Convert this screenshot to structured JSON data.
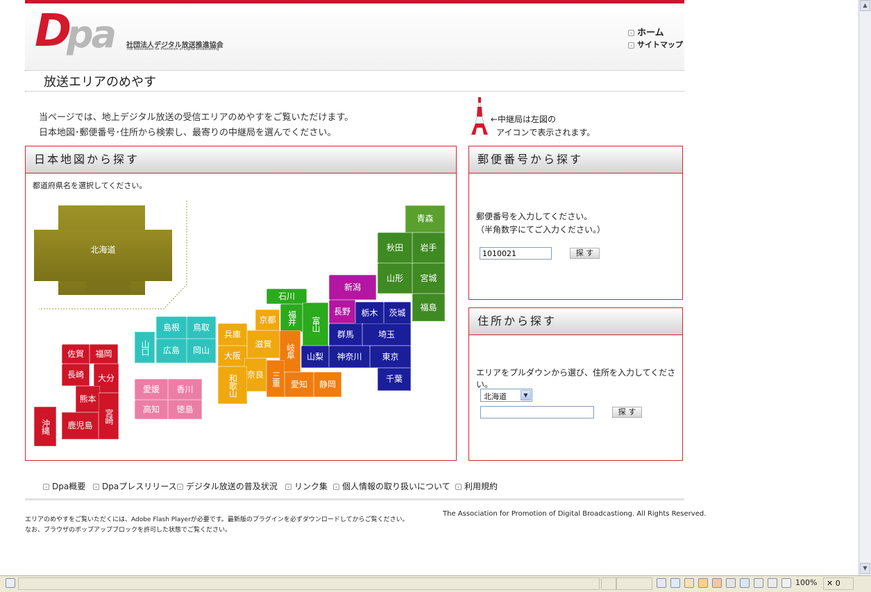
{
  "header": {
    "logo_d": "D",
    "logo_pa": "pa",
    "org_name_ja": "社団法人デジタル放送推進協会",
    "org_name_en": "The Association for Promotion of Digital Broadcasting",
    "nav_home": "ホーム",
    "nav_sitemap": "サイトマップ"
  },
  "page": {
    "title": "放送エリアのめやす",
    "intro_line1": "当ページでは、地上デジタル放送の受信エリアのめやすをご覧いただけます。",
    "intro_line2": "日本地図･郵便番号･住所から検索し、最寄りの中継局を選んでください。",
    "tower_note_line1": "←中継局は左図の",
    "tower_note_line2": "アイコンで表示されます。"
  },
  "map_panel": {
    "heading": "日本地図から探す",
    "instruction": "都道府県名を選択してください。",
    "prefectures": {
      "hokkaido": "北海道",
      "aomori": "青森",
      "akita": "秋田",
      "iwate": "岩手",
      "yamagata": "山形",
      "miyagi": "宮城",
      "fukushima": "福島",
      "niigata": "新潟",
      "nagano": "長野",
      "tochigi": "栃木",
      "ibaraki": "茨城",
      "gunma": "群馬",
      "saitama": "埼玉",
      "yamanashi": "山梨",
      "kanagawa": "神奈川",
      "tokyo": "東京",
      "chiba": "千葉",
      "ishikawa": "石川",
      "fukui": "福井",
      "toyama": "富山",
      "gifu": "岐阜",
      "aichi": "愛知",
      "shizuoka": "静岡",
      "mie": "三重",
      "kyoto": "京都",
      "hyogo": "兵庫",
      "shiga": "滋賀",
      "osaka": "大阪",
      "nara": "奈良",
      "wakayama": "和歌山",
      "shimane": "島根",
      "tottori": "鳥取",
      "yamaguchi": "山口",
      "hiroshima": "広島",
      "okayama": "岡山",
      "ehime": "愛媛",
      "kagawa": "香川",
      "kochi": "高知",
      "tokushima": "徳島",
      "saga": "佐賀",
      "fukuoka": "福岡",
      "nagasaki": "長崎",
      "oita": "大分",
      "kumamoto": "熊本",
      "miyazaki": "宮崎",
      "kagoshima": "鹿児島",
      "okinawa": "沖縄"
    },
    "colors": {
      "hokkaido": "#8a7f1e",
      "tohoku": "#3f8a22",
      "aomori": "#5aa02e",
      "kanto": "#1a1e9a",
      "chubu_n": "#2aaa1c",
      "chubu": "#ef7c0e",
      "kinki": "#efa80e",
      "koshinetsu": "#b316a0",
      "chugoku": "#2fc3bd",
      "shikoku": "#ec7ea6",
      "kyushu": "#cf1528"
    }
  },
  "postal_panel": {
    "heading": "郵便番号から探す",
    "instruction_line1": "郵便番号を入力してください。",
    "instruction_line2": "（半角数字にてご入力ください。）",
    "input_value": "1010021",
    "search_button": "探 す"
  },
  "address_panel": {
    "heading": "住所から探す",
    "instruction": "エリアをプルダウンから選び、住所を入力してください。",
    "selected_prefecture": "北海道",
    "address_value": "",
    "search_button": "探 す"
  },
  "footer": {
    "links": [
      "Dpa概要",
      "Dpaプレスリリース",
      "デジタル放送の普及状況",
      "リンク集",
      "個人情報の取り扱いについて",
      "利用規約"
    ],
    "note_line1": "エリアのめやすをご覧いただくには、Adobe Flash Playerが必要です。最新版のプラグインを必ずダウンロードしてからご覧ください。",
    "note_line2": "なお、ブラウザのポップアップブロックを許可した状態でご覧ください。",
    "copyright": "The Association for Promotion of Digital Broadcastiong. All Rights Reserved."
  },
  "statusbar": {
    "zoom": "100%",
    "count": "0"
  }
}
